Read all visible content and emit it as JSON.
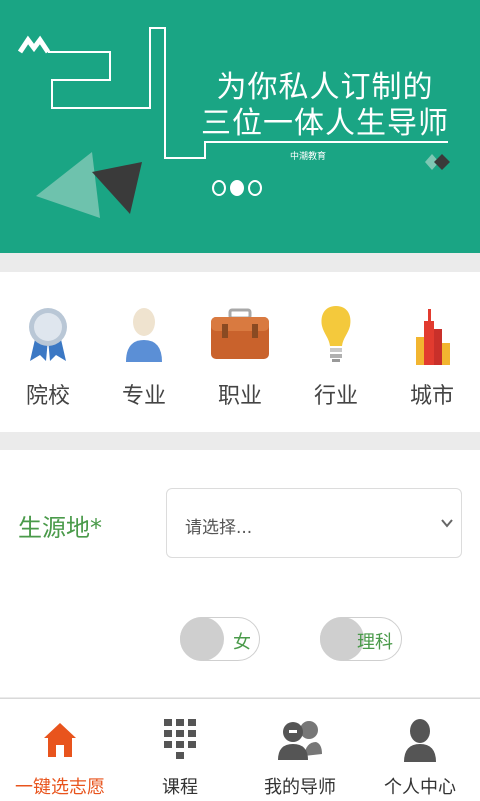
{
  "banner": {
    "title_line1": "为你私人订制的",
    "title_line2": "三位一体人生导师",
    "brand": "中潮教育",
    "background_color": "#1aa584",
    "slide_count": 3,
    "active_slide": 2
  },
  "categories": [
    {
      "label": "院校",
      "icon": "ribbon-medal-icon"
    },
    {
      "label": "专业",
      "icon": "person-bust-icon"
    },
    {
      "label": "职业",
      "icon": "briefcase-icon"
    },
    {
      "label": "行业",
      "icon": "lightbulb-icon"
    },
    {
      "label": "城市",
      "icon": "city-buildings-icon"
    }
  ],
  "form": {
    "origin_label": "生源地*",
    "origin_select_placeholder": "请选择...",
    "gender_toggle": "女",
    "subject_toggle": "理科",
    "label_color": "#4a9a4a"
  },
  "bottom_nav": [
    {
      "label": "一键选志愿",
      "icon": "home-icon",
      "active": true
    },
    {
      "label": "课程",
      "icon": "keypad-grid-icon",
      "active": false
    },
    {
      "label": "我的导师",
      "icon": "mentor-chat-icon",
      "active": false
    },
    {
      "label": "个人中心",
      "icon": "user-profile-icon",
      "active": false
    }
  ],
  "accent_color": "#e8541d"
}
